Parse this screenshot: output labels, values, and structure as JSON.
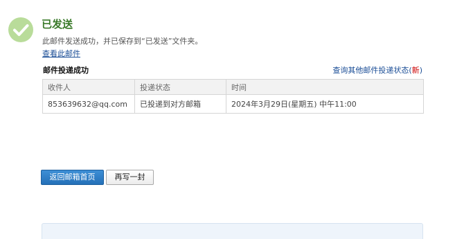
{
  "status": {
    "title": "已发送",
    "description": "此邮件发送成功，并已保存到“已发送”文件夹。",
    "view_link": "查看此邮件",
    "success_color": "#3a7a2a",
    "icon": "check-circle-icon"
  },
  "delivery": {
    "title": "邮件投递成功",
    "query_link_text": "查询其他邮件投递状态",
    "query_link_open": "(",
    "query_link_new": "新",
    "query_link_close": ")"
  },
  "table": {
    "headers": [
      "收件人",
      "投递状态",
      "时间"
    ],
    "rows": [
      [
        "853639632@qq.com",
        "已投递到对方邮箱",
        "2024年3月29日(星期五) 中午11:00"
      ]
    ]
  },
  "buttons": {
    "back_home": "返回邮箱首页",
    "compose_another": "再写一封"
  },
  "colors": {
    "link": "#1a4d96",
    "new_badge": "#cc0000",
    "primary_button": "#2470b8"
  }
}
